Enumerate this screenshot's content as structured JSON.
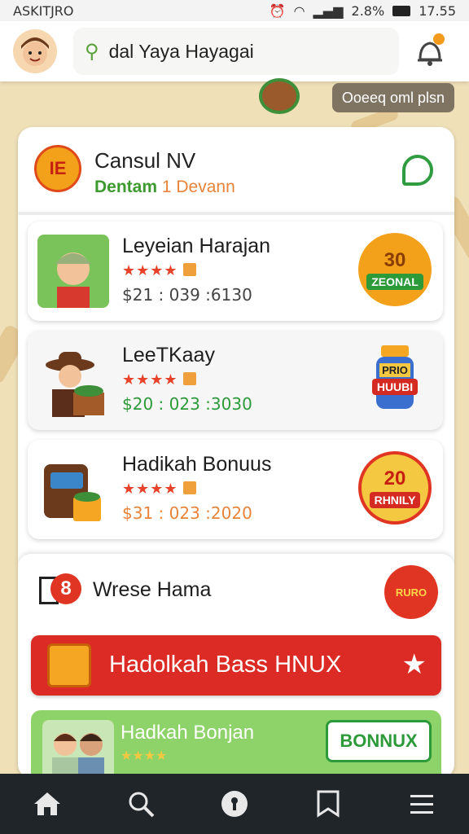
{
  "status_bar": {
    "left": "ASKITJRO",
    "battery": "2.8%",
    "time": "17.55"
  },
  "search": {
    "value": "dal Yaya Hayagai"
  },
  "plan_chip": "Ooeeq oml plsn",
  "section": {
    "title": "Cansul NV",
    "subtitle_main": "Dentam",
    "subtitle_accent": "1 Devann",
    "logo_text": "IE"
  },
  "offers": [
    {
      "name": "Leyeian Harajan",
      "price": "$21 : 039 :6130",
      "price_color": "#444444",
      "badge_big": "30",
      "badge_ribbon": "ZEONAL",
      "badge_color": "#f3a11b",
      "ribbon_color": "#2d9a3a"
    },
    {
      "name": "LeeTKaay",
      "price": "$20 : 023 :3030",
      "price_color": "#2d9a3a",
      "badge_big": "PRIO",
      "badge_ribbon": "HUUBI",
      "badge_color": "#f5c842",
      "ribbon_color": "#d52a22"
    },
    {
      "name": "Hadikah Bonuus",
      "price": "$31 : 023 :2020",
      "price_color": "#e8843a",
      "badge_big": "20",
      "badge_ribbon": "RHNILY",
      "badge_color": "#f5c842",
      "ribbon_color": "#d52a22"
    }
  ],
  "rewards": {
    "title": "Wrese Hama",
    "number": "8",
    "seal": "RURO"
  },
  "red_button": "Hadolkah Bass HNUX",
  "green_card": {
    "label": "Hadkah Bonjan",
    "stars": "★★★★",
    "button": "BONNUX"
  },
  "colors": {
    "accent_green": "#2d9a3a",
    "accent_red": "#dc2b24",
    "accent_orange": "#f39a1c"
  },
  "nav_icons": [
    "home-icon",
    "search-icon",
    "lock-icon",
    "bookmark-icon",
    "menu-icon"
  ]
}
